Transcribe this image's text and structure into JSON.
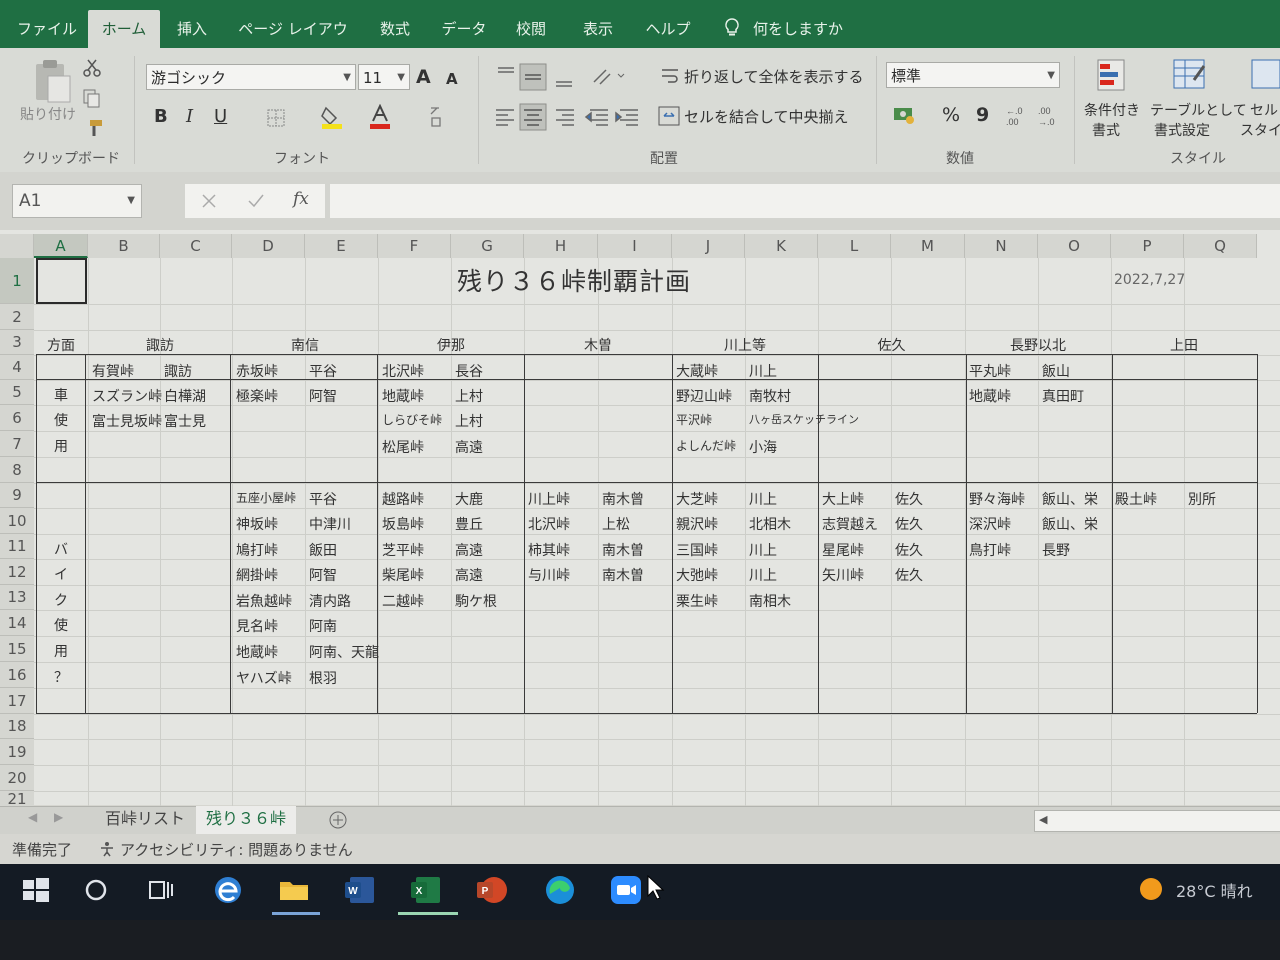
{
  "ribbon_tabs": [
    "ファイル",
    "ホーム",
    "挿入",
    "ページ レイアウト",
    "数式",
    "データ",
    "校閲",
    "表示",
    "ヘルプ"
  ],
  "tell_me": "何をしますか",
  "clipboard": {
    "paste": "貼り付け",
    "label": "クリップボード"
  },
  "font": {
    "name": "游ゴシック",
    "size": "11",
    "label": "フォント",
    "bold": "B",
    "italic": "I",
    "underline": "U",
    "grow": "A",
    "shrink": "A"
  },
  "alignment": {
    "wrap": "折り返して全体を表示する",
    "merge": "セルを結合して中央揃え",
    "label": "配置"
  },
  "number": {
    "format": "標準",
    "percent": "%",
    "comma": "9",
    "label": "数値"
  },
  "styles": {
    "conditional": "条件付き",
    "conditional2": "書式",
    "table": "テーブルとして",
    "table2": "書式設定",
    "cell": "セル",
    "cell2": "スタイル",
    "label": "スタイル"
  },
  "namebox": "A1",
  "fx": "fx",
  "columns": [
    "A",
    "B",
    "C",
    "D",
    "E",
    "F",
    "G",
    "H",
    "I",
    "J",
    "K",
    "L",
    "M",
    "N",
    "O",
    "P",
    "Q"
  ],
  "rows": [
    "1",
    "2",
    "3",
    "4",
    "5",
    "6",
    "7",
    "8",
    "9",
    "10",
    "11",
    "12",
    "13",
    "14",
    "15",
    "16",
    "17",
    "18",
    "19",
    "20",
    "21"
  ],
  "sheet": {
    "title": "残り３６峠制覇計画",
    "date": "2022,7,27",
    "headers": [
      "方面",
      "諏訪",
      "南信",
      "伊那",
      "木曽",
      "川上等",
      "佐久",
      "長野以北",
      "上田"
    ],
    "side_labels": [
      "車",
      "使",
      "用",
      "バ",
      "イ",
      "ク",
      "使",
      "用",
      "？"
    ],
    "cells": [
      [
        "有賀峠",
        "諏訪"
      ],
      [
        "スズラン峠",
        "白樺湖"
      ],
      [
        "富士見坂峠",
        "富士見"
      ],
      [
        "赤坂峠",
        "平谷"
      ],
      [
        "極楽峠",
        "阿智"
      ],
      [
        "北沢峠",
        "長谷"
      ],
      [
        "地蔵峠",
        "上村"
      ],
      [
        "しらびそ峠",
        "上村"
      ],
      [
        "松尾峠",
        "高遠"
      ],
      [
        "大蔵峠",
        "川上"
      ],
      [
        "野辺山峠",
        "南牧村"
      ],
      [
        "平沢峠",
        "八ヶ岳スケッチライン"
      ],
      [
        "よしんだ峠",
        "小海"
      ],
      [
        "平丸峠",
        "飯山"
      ],
      [
        "地蔵峠",
        "真田町"
      ],
      [
        "五座小屋峠",
        "平谷"
      ],
      [
        "神坂峠",
        "中津川"
      ],
      [
        "鳩打峠",
        "飯田"
      ],
      [
        "網掛峠",
        "阿智"
      ],
      [
        "岩魚越峠",
        "清内路"
      ],
      [
        "見名峠",
        "阿南"
      ],
      [
        "地蔵峠",
        "阿南、天龍"
      ],
      [
        "ヤハズ峠",
        "根羽"
      ],
      [
        "越路峠",
        "大鹿"
      ],
      [
        "坂島峠",
        "豊丘"
      ],
      [
        "芝平峠",
        "高遠"
      ],
      [
        "柴尾峠",
        "高遠"
      ],
      [
        "二越峠",
        "駒ケ根"
      ],
      [
        "川上峠",
        "南木曾"
      ],
      [
        "北沢峠",
        "上松"
      ],
      [
        "柿其峠",
        "南木曽"
      ],
      [
        "与川峠",
        "南木曽"
      ],
      [
        "大芝峠",
        "川上"
      ],
      [
        "親沢峠",
        "北相木"
      ],
      [
        "三国峠",
        "川上"
      ],
      [
        "大弛峠",
        "川上"
      ],
      [
        "栗生峠",
        "南相木"
      ],
      [
        "大上峠",
        "佐久"
      ],
      [
        "志賀越え",
        "佐久"
      ],
      [
        "星尾峠",
        "佐久"
      ],
      [
        "矢川峠",
        "佐久"
      ],
      [
        "野々海峠",
        "飯山、栄"
      ],
      [
        "深沢峠",
        "飯山、栄"
      ],
      [
        "鳥打峠",
        "長野"
      ],
      [
        "殿土峠",
        "別所"
      ]
    ]
  },
  "sheet_tabs": [
    "百峠リスト",
    "残り３６峠"
  ],
  "status": {
    "ready": "準備完了",
    "accessibility": "アクセシビリティ: 問題ありません"
  },
  "weather": "28°C 晴れ",
  "taskbar_icons": [
    "windows-start",
    "search-circle",
    "task-view",
    "edge-legacy",
    "file-explorer",
    "word",
    "excel",
    "powerpoint",
    "edge",
    "zoom"
  ],
  "accent": "#1f6f43"
}
